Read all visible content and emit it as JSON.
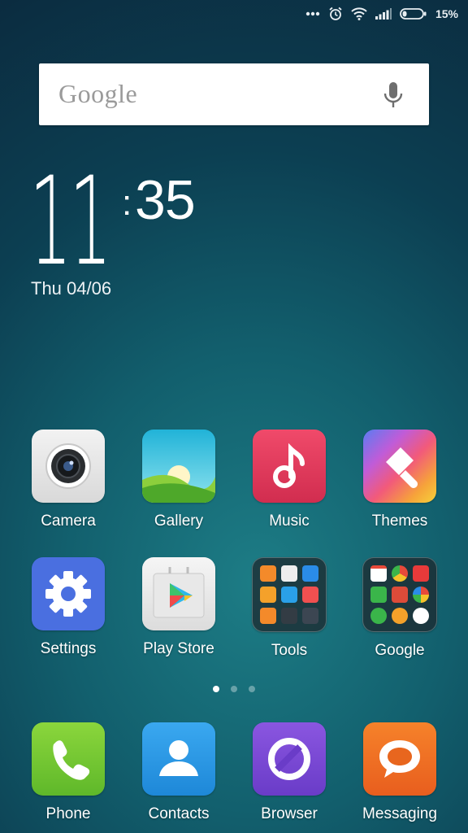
{
  "status_bar": {
    "battery_percent": "15%",
    "icons": [
      "more-dots-icon",
      "alarm-icon",
      "wifi-icon",
      "signal-icon",
      "battery-icon"
    ]
  },
  "search": {
    "logo": "Google",
    "icon": "mic-icon"
  },
  "clock": {
    "hours": "11",
    "colon": ":",
    "minutes": "35",
    "date": "Thu 04/06"
  },
  "apps": [
    {
      "label": "Camera"
    },
    {
      "label": "Gallery"
    },
    {
      "label": "Music"
    },
    {
      "label": "Themes"
    },
    {
      "label": "Settings"
    },
    {
      "label": "Play Store"
    },
    {
      "label": "Tools"
    },
    {
      "label": "Google"
    }
  ],
  "page_indicator": {
    "count": 3,
    "active": 1
  },
  "dock": [
    {
      "label": "Phone"
    },
    {
      "label": "Contacts"
    },
    {
      "label": "Browser"
    },
    {
      "label": "Messaging"
    }
  ]
}
